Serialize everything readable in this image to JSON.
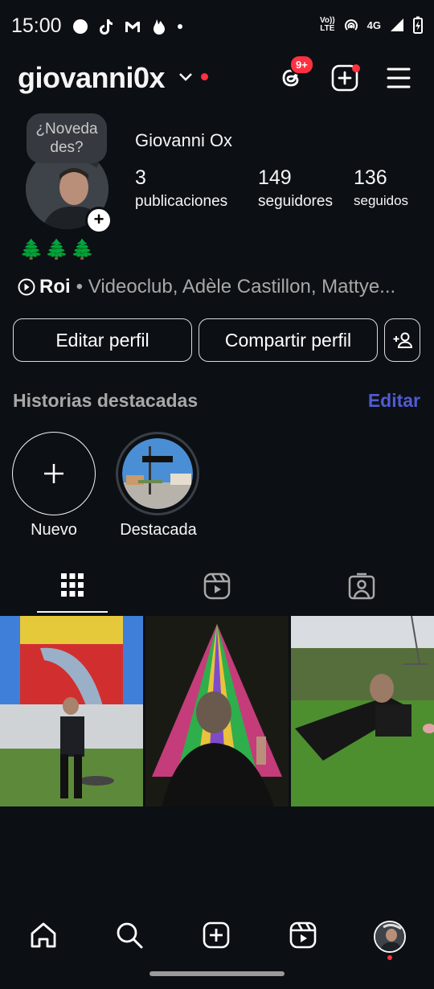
{
  "status_bar": {
    "time": "15:00",
    "volte_top": "Vo))",
    "volte_bottom": "LTE",
    "network": "4G"
  },
  "header": {
    "username": "giovanni0x",
    "threads_badge": "9+"
  },
  "profile": {
    "note": "¿Novedades?",
    "note_line1": "¿Noveda",
    "note_line2": "des?",
    "full_name": "Giovanni Ox",
    "stats": [
      {
        "value": "3",
        "label": "publicaciones"
      },
      {
        "value": "149",
        "label": "seguidores"
      },
      {
        "value": "136",
        "label": "seguidos"
      }
    ],
    "bio_emojis": "🌲🌲🌲",
    "music_title": "Roi",
    "music_artists": "• Videoclub, Adèle Castillon, Mattye..."
  },
  "buttons": {
    "edit_profile": "Editar perfil",
    "share_profile": "Compartir perfil"
  },
  "highlights": {
    "title": "Historias destacadas",
    "edit": "Editar",
    "items": [
      {
        "label": "Nuevo"
      },
      {
        "label": "Destacada"
      }
    ]
  },
  "colors": {
    "background": "#0c1014",
    "accent_link": "#4f5bd5",
    "notification_red": "#ff3040"
  },
  "icons": [
    "threads-icon",
    "create-icon",
    "menu-icon",
    "grid-icon",
    "reels-icon",
    "tagged-icon",
    "home-icon",
    "search-icon",
    "add-post-icon",
    "reels-nav-icon",
    "profile-avatar-icon"
  ]
}
